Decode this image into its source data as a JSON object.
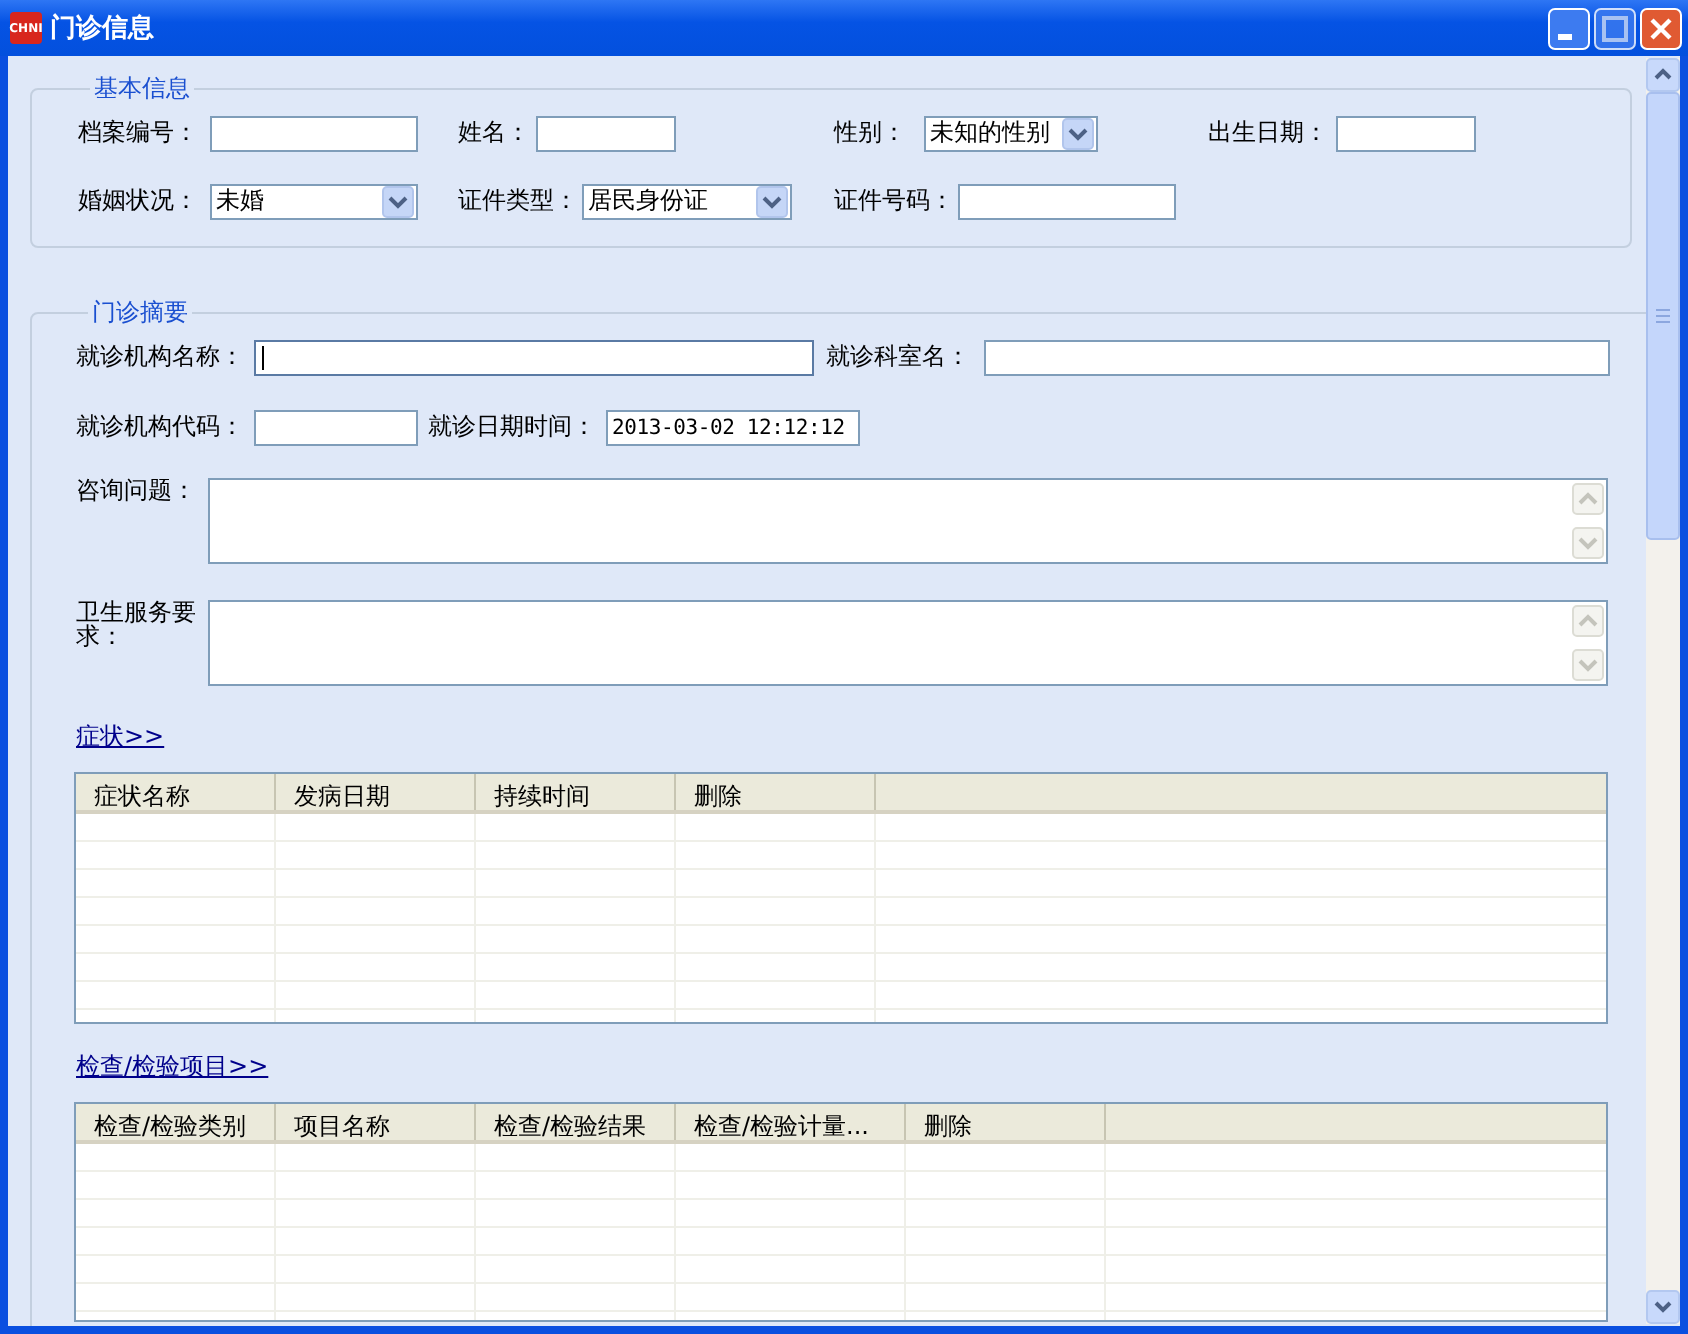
{
  "window": {
    "icon_text": "CHNI",
    "title": "门诊信息"
  },
  "basic_info": {
    "title": "基本信息",
    "rows": [
      [
        {
          "label": "档案编号：",
          "kind": "text"
        },
        {
          "label": "姓名：",
          "kind": "text"
        },
        {
          "label": "性别：",
          "kind": "select",
          "value": "未知的性别"
        },
        {
          "label": "出生日期：",
          "kind": "text"
        }
      ],
      [
        {
          "label": "婚姻状况：",
          "kind": "select",
          "value": "未婚"
        },
        {
          "label": "证件类型：",
          "kind": "select",
          "value": "居民身份证"
        },
        {
          "label": "证件号码：",
          "kind": "text"
        }
      ]
    ]
  },
  "summary": {
    "title": "门诊摘要",
    "rows": [
      [
        {
          "label": "就诊机构名称：",
          "kind": "text",
          "focused": true
        },
        {
          "label": "就诊科室名：",
          "kind": "text",
          "focused": false
        }
      ],
      [
        {
          "label": "就诊机构代码：",
          "kind": "text",
          "focused": false
        },
        {
          "label": "就诊日期时间：",
          "kind": "text",
          "value": "2013-03-02 12:12:12",
          "focused": false
        }
      ]
    ],
    "text_areas": [
      {
        "label": "咨询问题："
      },
      {
        "label": "卫生服务要求："
      }
    ],
    "symptoms": {
      "link": "症状>>",
      "columns": [
        "症状名称",
        "发病日期",
        "持续时间",
        "删除"
      ]
    },
    "exams": {
      "link": "检查/检验项目>>",
      "columns": [
        "检查/检验类别",
        "项目名称",
        "检查/检验结果",
        "检查/检验计量...",
        "删除"
      ]
    }
  }
}
